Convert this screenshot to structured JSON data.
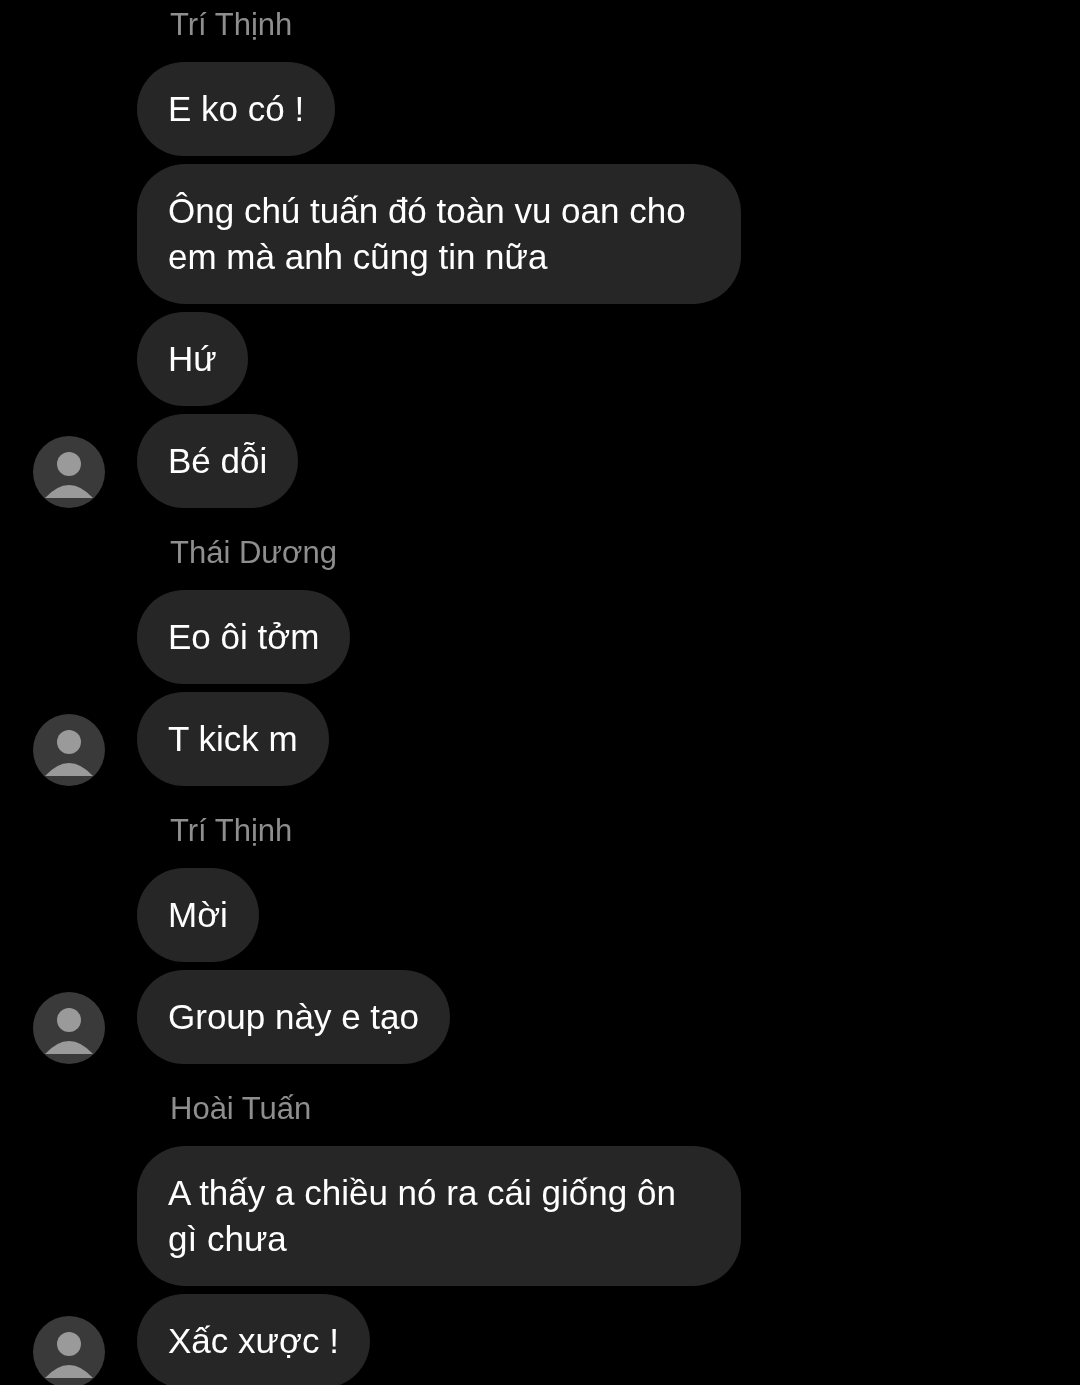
{
  "groups": [
    {
      "sender": "Trí Thịnh",
      "avatar_shown": true,
      "messages": [
        "E ko có !",
        "Ông chú tuấn đó toàn vu oan cho em mà anh cũng tin nữa",
        "Hứ",
        "Bé dỗi"
      ]
    },
    {
      "sender": "Thái Dương",
      "avatar_shown": true,
      "messages": [
        "Eo ôi tởm",
        "T kick m"
      ]
    },
    {
      "sender": "Trí Thịnh",
      "avatar_shown": true,
      "messages": [
        "Mời",
        "Group này e tạo"
      ]
    },
    {
      "sender": "Hoài Tuấn",
      "avatar_shown": true,
      "messages": [
        "A thấy a chiều nó ra cái giống ôn gì chưa",
        "Xấc xược !"
      ]
    }
  ]
}
